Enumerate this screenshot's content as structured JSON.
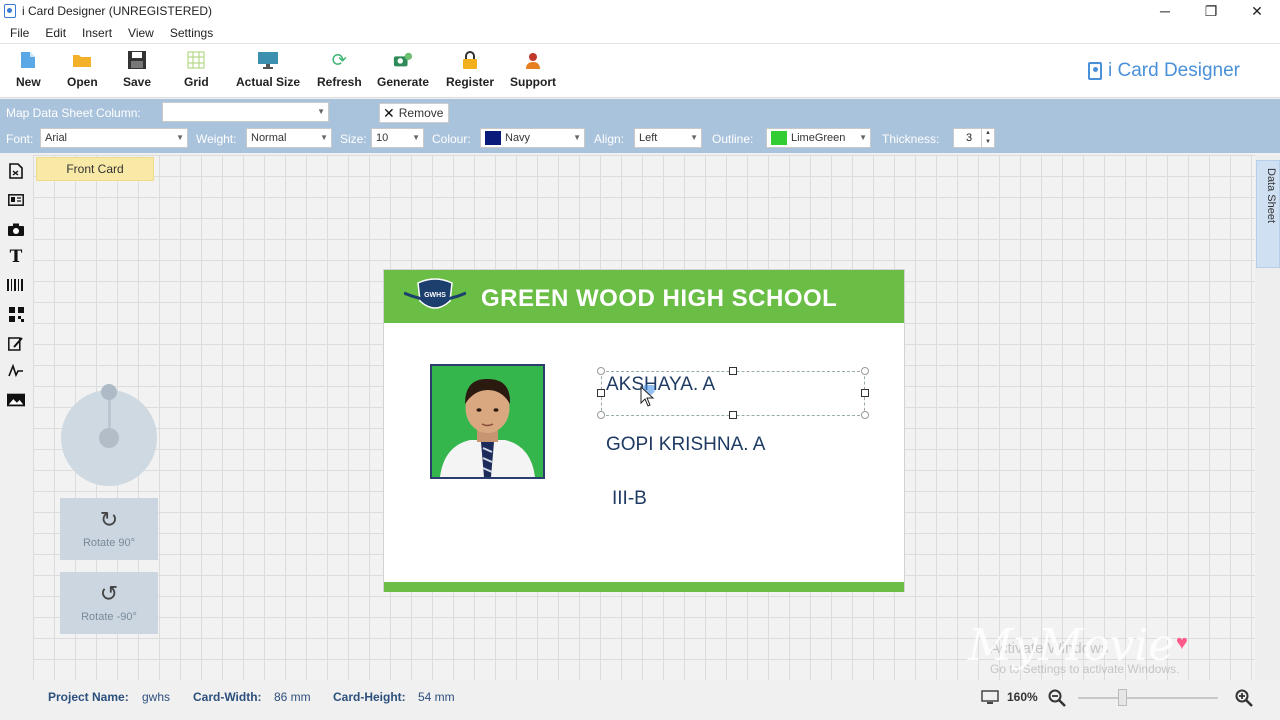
{
  "window": {
    "title": "i Card Designer (UNREGISTERED)",
    "minimize": "─",
    "restore": "❐",
    "close": "✕"
  },
  "menu": [
    "File",
    "Edit",
    "Insert",
    "View",
    "Settings"
  ],
  "toolbar": {
    "items": [
      {
        "label": "New",
        "icon": "new-document-icon"
      },
      {
        "label": "Open",
        "icon": "folder-icon"
      },
      {
        "label": "Save",
        "icon": "floppy-disk-icon"
      },
      {
        "label": "Grid",
        "icon": "grid-icon"
      },
      {
        "label": "Actual Size",
        "icon": "monitor-icon"
      },
      {
        "label": "Refresh",
        "icon": "refresh-icon"
      },
      {
        "label": "Generate",
        "icon": "generate-icon"
      },
      {
        "label": "Register",
        "icon": "lock-icon"
      },
      {
        "label": "Support",
        "icon": "support-person-icon"
      }
    ],
    "brand": "i Card Designer"
  },
  "properties": {
    "map_column_label": "Map Data Sheet Column:",
    "map_column_value": "",
    "remove_label": "Remove",
    "font_label": "Font:",
    "font_value": "Arial",
    "weight_label": "Weight:",
    "weight_value": "Normal",
    "size_label": "Size:",
    "size_value": "10",
    "colour_label": "Colour:",
    "colour_value": "Navy",
    "colour_hex": "#0a1a7a",
    "align_label": "Align:",
    "align_value": "Left",
    "outline_label": "Outline:",
    "outline_value": "LimeGreen",
    "outline_hex": "#32cd32",
    "thickness_label": "Thickness:",
    "thickness_value": "3"
  },
  "left_tools": [
    "document-icon",
    "id-card-icon",
    "camera-icon",
    "text-tool-icon",
    "barcode-icon",
    "qr-code-icon",
    "signature-pad-icon",
    "signature-icon",
    "image-icon"
  ],
  "canvas": {
    "tab_front": "Front Card",
    "data_sheet_tab": "Data Sheet",
    "rotate_cw_label": "Rotate 90°",
    "rotate_ccw_label": "Rotate -90°"
  },
  "card": {
    "school_name": "GREEN WOOD HIGH SCHOOL",
    "logo_text": "GWHS",
    "student_name": "AKSHAYA. A",
    "parent_name": "GOPI KRISHNA. A",
    "class": "III-B",
    "header_color": "#6abd45",
    "text_color": "#1f3b63"
  },
  "status": {
    "project_name_label": "Project Name:",
    "project_name_value": "gwhs",
    "card_width_label": "Card-Width:",
    "card_width_value": "86 mm",
    "card_height_label": "Card-Height:",
    "card_height_value": "54 mm",
    "zoom": "160%"
  },
  "overlay": {
    "watermark": "MyMovie",
    "activate_line1": "Activate Windows",
    "activate_line2": "Go to Settings to activate Windows."
  }
}
